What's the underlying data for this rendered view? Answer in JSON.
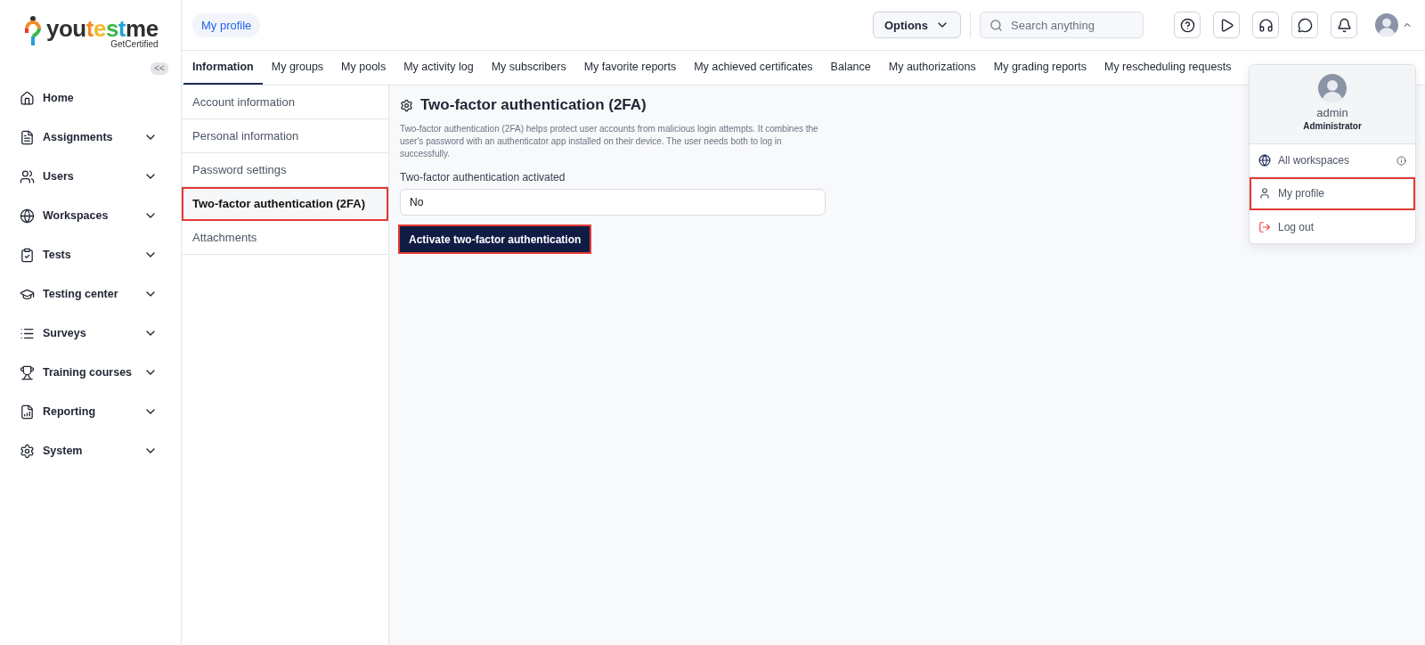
{
  "logo": {
    "parts": [
      {
        "text": "you",
        "color": "#2f2f2f"
      },
      {
        "text": "t",
        "color": "#f28c28"
      },
      {
        "text": "e",
        "color": "#f5b82e"
      },
      {
        "text": "s",
        "color": "#3bb54a"
      },
      {
        "text": "t",
        "color": "#1fa3d9"
      },
      {
        "text": "me",
        "color": "#2f2f2f"
      }
    ],
    "tagline": "GetCertified",
    "collapse": "<<"
  },
  "sidebar": {
    "items": [
      {
        "label": "Home",
        "kind": "link"
      },
      {
        "label": "Assignments",
        "kind": "group"
      },
      {
        "label": "Users",
        "kind": "group"
      },
      {
        "label": "Workspaces",
        "kind": "group"
      },
      {
        "label": "Tests",
        "kind": "group"
      },
      {
        "label": "Testing center",
        "kind": "group"
      },
      {
        "label": "Surveys",
        "kind": "group"
      },
      {
        "label": "Training courses",
        "kind": "group"
      },
      {
        "label": "Reporting",
        "kind": "group"
      },
      {
        "label": "System",
        "kind": "group"
      }
    ]
  },
  "header": {
    "breadcrumb": "My profile",
    "options": "Options",
    "search": {
      "placeholder": "Search anything"
    }
  },
  "tabs": [
    {
      "label": "Information",
      "selected": true
    },
    {
      "label": "My groups",
      "selected": false
    },
    {
      "label": "My pools",
      "selected": false
    },
    {
      "label": "My activity log",
      "selected": false
    },
    {
      "label": "My subscribers",
      "selected": false
    },
    {
      "label": "My favorite reports",
      "selected": false
    },
    {
      "label": "My achieved certificates",
      "selected": false
    },
    {
      "label": "Balance",
      "selected": false
    },
    {
      "label": "My authorizations",
      "selected": false
    },
    {
      "label": "My grading reports",
      "selected": false
    },
    {
      "label": "My rescheduling requests",
      "selected": false
    }
  ],
  "subnav": [
    {
      "label": "Account information",
      "selected": false,
      "highlighted": false
    },
    {
      "label": "Personal information",
      "selected": false,
      "highlighted": false
    },
    {
      "label": "Password settings",
      "selected": false,
      "highlighted": false
    },
    {
      "label": "Two-factor authentication (2FA)",
      "selected": true,
      "highlighted": true
    },
    {
      "label": "Attachments",
      "selected": false,
      "highlighted": false
    }
  ],
  "content": {
    "title": "Two-factor authentication (2FA)",
    "description": "Two-factor authentication (2FA) helps protect user accounts from malicious login attempts. It combines the user's password with an authenticator app installed on their device. The user needs both to log in successfully.",
    "field_label": "Two-factor authentication activated",
    "field_value": "No",
    "button": {
      "label": "Activate two-factor authentication",
      "highlighted": true
    }
  },
  "user_menu": {
    "name": "admin",
    "role": "Administrator",
    "items": [
      {
        "label": "All workspaces",
        "kind": "info",
        "highlighted": false
      },
      {
        "label": "My profile",
        "kind": "profile",
        "highlighted": true
      },
      {
        "label": "Log out",
        "kind": "logout",
        "highlighted": false
      }
    ]
  }
}
